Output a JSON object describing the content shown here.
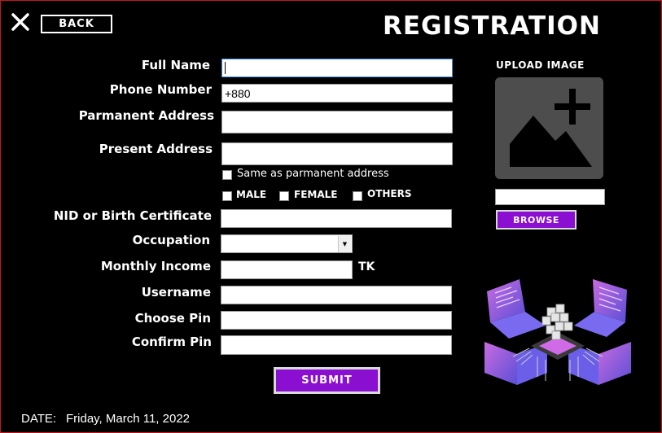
{
  "header": {
    "back_label": "BACK",
    "title": "REGISTRATION",
    "close_icon": "close-icon"
  },
  "form": {
    "full_name": {
      "label": "Full Name",
      "value": ""
    },
    "phone_number": {
      "label": "Phone Number",
      "value": "+880"
    },
    "permanent_address": {
      "label": "Parmanent Address",
      "value": ""
    },
    "present_address": {
      "label": "Present Address",
      "value": ""
    },
    "same_as_permanent": {
      "label": "Same as parmanent address",
      "checked": false
    },
    "gender": {
      "options": [
        {
          "label": "MALE",
          "checked": false
        },
        {
          "label": "FEMALE",
          "checked": false
        },
        {
          "label": "OTHERS",
          "checked": false
        }
      ]
    },
    "nid": {
      "label": "NID or Birth Certificate",
      "value": ""
    },
    "occupation": {
      "label": "Occupation",
      "value": ""
    },
    "monthly_income": {
      "label": "Monthly Income",
      "value": "",
      "unit": "TK"
    },
    "username": {
      "label": "Username",
      "value": ""
    },
    "choose_pin": {
      "label": "Choose Pin",
      "value": ""
    },
    "confirm_pin": {
      "label": "Confirm Pin",
      "value": ""
    },
    "submit_label": "SUBMIT"
  },
  "upload": {
    "label": "UPLOAD IMAGE",
    "file_path": "",
    "browse_label": "BROWSE",
    "icon": "add-image-icon"
  },
  "footer": {
    "date_label": "DATE:",
    "date_value": "Friday, March 11, 2022"
  },
  "colors": {
    "background": "#000000",
    "accent": "#8a0fd0",
    "border_red": "#c8171d",
    "image_placeholder": "#4d4d4d"
  }
}
